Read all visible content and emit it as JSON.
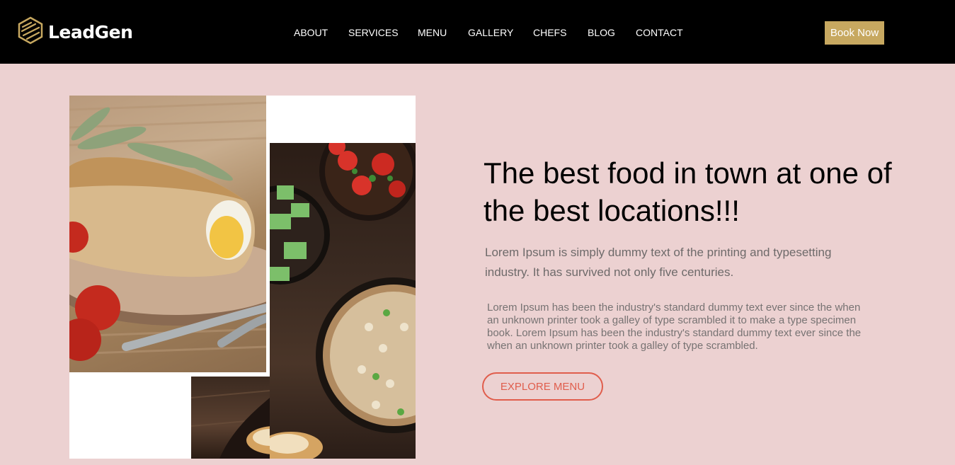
{
  "brand": {
    "name": "LeadGen",
    "logo_icon": "hexagon-logo-icon",
    "accent": "#c7a860"
  },
  "nav": {
    "items": [
      "ABOUT",
      "SERVICES",
      "MENU",
      "GALLERY",
      "CHEFS",
      "BLOG",
      "CONTACT"
    ],
    "cta_label": "Book Now"
  },
  "hero": {
    "headline": "The best food in town at one of the best locations!!!",
    "lead": "Lorem Ipsum is simply dummy text of the printing and typesetting industry. It has survived not only five centuries.",
    "body": "Lorem Ipsum has been the industry's standard dummy text ever since the when an unknown printer took a galley of type scrambled it to make a type specimen book. Lorem Ipsum has been the industry's standard dummy text ever since the when an unknown printer took a galley of type scrambled.",
    "button_label": "EXPLORE MENU",
    "button_color": "#e05d4c"
  },
  "colors": {
    "header_bg": "#000000",
    "page_bg": "#ecd1d1"
  }
}
